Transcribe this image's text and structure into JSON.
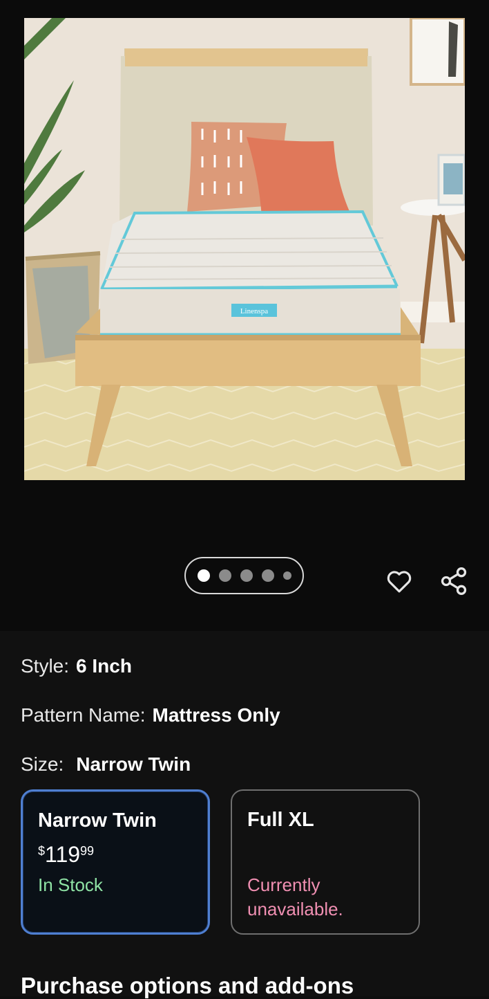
{
  "product_image": {
    "alt": "Linenspa twin mattress on a wooden bed frame",
    "mattress_label": "Linenspa"
  },
  "carousel": {
    "total_images": 5,
    "active_index": 0
  },
  "actions": {
    "favorite_icon": "heart-outline-icon",
    "share_icon": "share-icon"
  },
  "attributes": {
    "style_label": "Style:",
    "style_value": "6 Inch",
    "pattern_label": "Pattern Name:",
    "pattern_value": "Mattress Only",
    "size_label": "Size:",
    "size_value": "Narrow Twin"
  },
  "size_options": [
    {
      "name": "Narrow Twin",
      "price_symbol": "$",
      "price_whole": "119",
      "price_fraction": "99",
      "status": "In Stock",
      "selected": true
    },
    {
      "name": "Full XL",
      "status": "Currently unavailable.",
      "selected": false
    }
  ],
  "purchase_section_title": "Purchase options and add-ons",
  "colors": {
    "background": "#0e0e0e",
    "selected_border": "#4f7fd1",
    "in_stock": "#8fe3a5",
    "unavailable": "#f08fb2"
  }
}
